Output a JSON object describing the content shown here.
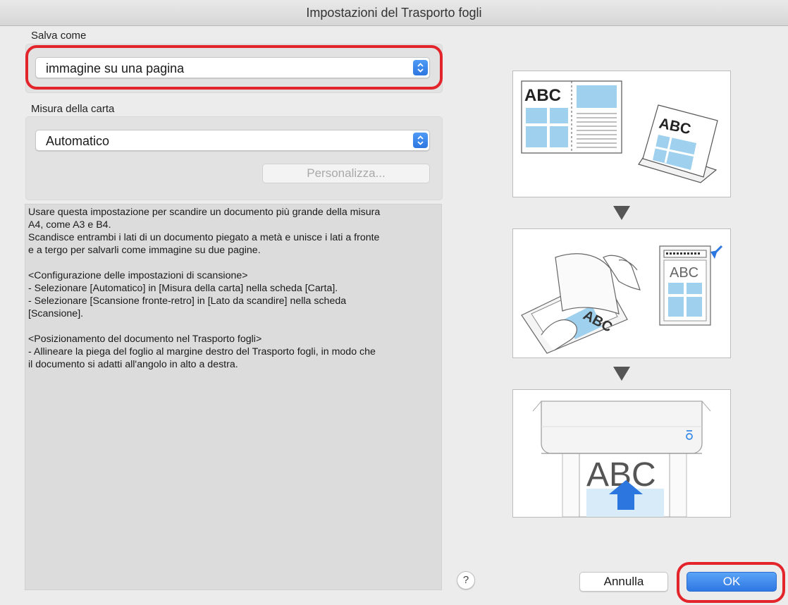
{
  "window": {
    "title": "Impostazioni del Trasporto fogli"
  },
  "save_as": {
    "label": "Salva come",
    "value": "immagine su una pagina"
  },
  "paper_size": {
    "label": "Misura della carta",
    "value": "Automatico",
    "custom_button": "Personalizza..."
  },
  "description": {
    "lines": [
      "Usare questa impostazione per scandire un documento più grande della misura",
      "A4, come A3 e B4.",
      "Scandisce entrambi i lati di un documento piegato a metà e unisce i lati a fronte",
      "e a tergo per salvarli come immagine su due pagine.",
      "",
      "<Configurazione delle impostazioni di scansione>",
      "- Selezionare [Automatico] in [Misura della carta] nella scheda [Carta].",
      "- Selezionare [Scansione fronte-retro] in [Lato da scandire] nella scheda",
      "[Scansione].",
      "",
      "<Posizionamento del documento nel Trasporto fogli>",
      "- Allineare la piega del foglio al margine destro del Trasporto fogli, in modo che",
      "il documento si adatti all'angolo in alto a destra."
    ]
  },
  "illustrations": {
    "panel1_text_a": "ABC",
    "panel1_text_b": "ABC",
    "panel2_text": "ABC",
    "panel3_text": "ABC"
  },
  "footer": {
    "help": "?",
    "cancel": "Annulla",
    "ok": "OK"
  },
  "colors": {
    "highlight": "#e3242b",
    "accent": "#2f77e3",
    "illustration_blue": "#9fd0ee"
  }
}
